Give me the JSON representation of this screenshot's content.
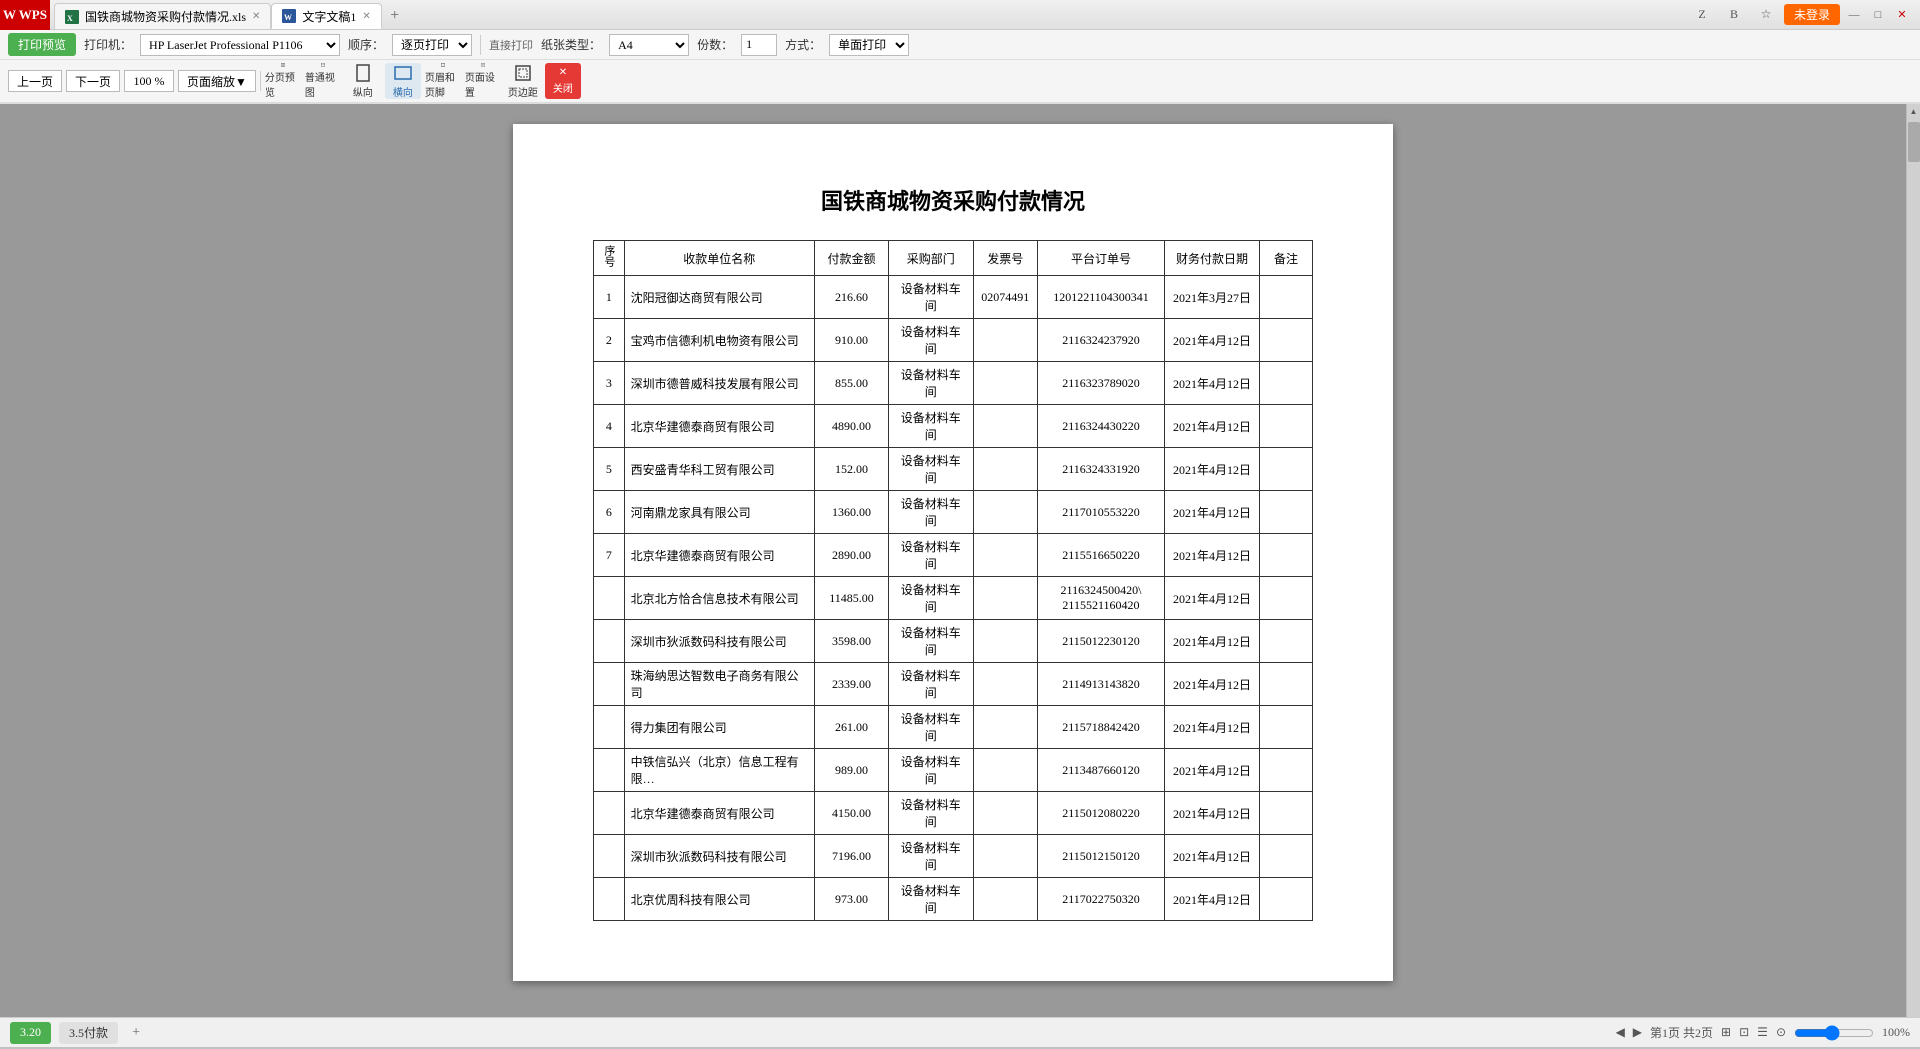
{
  "titlebar": {
    "wps_logo": "W WPS",
    "tabs": [
      {
        "id": "tab1",
        "label": "国铁商城物资采购付款情况.xls",
        "active": false,
        "icon": "xlsx"
      },
      {
        "id": "tab2",
        "label": "文字文稿1",
        "active": true,
        "icon": "doc"
      }
    ],
    "new_tab": "+",
    "right_buttons": [
      "Z",
      "B",
      "☆"
    ],
    "login_label": "未登录",
    "win_min": "—",
    "win_max": "□",
    "win_close": "✕"
  },
  "toolbar": {
    "print_preview_label": "打印预览",
    "printer_label": "打印机：",
    "printer_value": "HP LaserJet Professional P1106",
    "order_label": "顺序：",
    "order_value": "逐页打印",
    "paper_label": "纸张类型：",
    "paper_value": "A4",
    "copies_label": "份数：",
    "copies_value": "1",
    "mode_label": "方式：",
    "mode_value": "单面打印",
    "direct_print": "直接打印"
  },
  "toolbar2": {
    "prev_label": "上一页",
    "next_label": "下一页",
    "zoom_value": "100 %",
    "zoom_label": "页面缩放▼",
    "buttons": [
      {
        "id": "split-preview",
        "label": "分页预览",
        "active": false
      },
      {
        "id": "normal-view",
        "label": "普通视图",
        "active": false
      },
      {
        "id": "portrait",
        "label": "纵向",
        "active": false
      },
      {
        "id": "landscape",
        "label": "横向",
        "active": true
      },
      {
        "id": "header-footer",
        "label": "页眉和页脚",
        "active": false
      },
      {
        "id": "page-setup",
        "label": "页面设置",
        "active": false
      },
      {
        "id": "margins",
        "label": "页边距",
        "active": false
      },
      {
        "id": "close",
        "label": "关闭",
        "active": false
      }
    ]
  },
  "document": {
    "title": "国铁商城物资采购付款情况",
    "table": {
      "headers": [
        "序号",
        "收款单位名称",
        "付款金额",
        "采购部门",
        "发票号",
        "平台订单号",
        "财务付款日期",
        "备注"
      ],
      "rows": [
        {
          "seq": "1",
          "name": "沈阳冠御达商贸有限公司",
          "amount": "216.60",
          "dept": "设备材料车间",
          "invoice": "02074491",
          "order": "1201221104300341",
          "date": "2021年3月27日",
          "remark": ""
        },
        {
          "seq": "2",
          "name": "宝鸡市信德利机电物资有限公司",
          "amount": "910.00",
          "dept": "设备材料车间",
          "invoice": "",
          "order": "2116324237920",
          "date": "2021年4月12日",
          "remark": ""
        },
        {
          "seq": "3",
          "name": "深圳市德普威科技发展有限公司",
          "amount": "855.00",
          "dept": "设备材料车间",
          "invoice": "",
          "order": "2116323789020",
          "date": "2021年4月12日",
          "remark": ""
        },
        {
          "seq": "4",
          "name": "北京华建德泰商贸有限公司",
          "amount": "4890.00",
          "dept": "设备材料车间",
          "invoice": "",
          "order": "2116324430220",
          "date": "2021年4月12日",
          "remark": ""
        },
        {
          "seq": "5",
          "name": "西安盛青华科工贸有限公司",
          "amount": "152.00",
          "dept": "设备材料车间",
          "invoice": "",
          "order": "2116324331920",
          "date": "2021年4月12日",
          "remark": ""
        },
        {
          "seq": "6",
          "name": "河南鼎龙家具有限公司",
          "amount": "1360.00",
          "dept": "设备材料车间",
          "invoice": "",
          "order": "2117010553220",
          "date": "2021年4月12日",
          "remark": ""
        },
        {
          "seq": "7",
          "name": "北京华建德泰商贸有限公司",
          "amount": "2890.00",
          "dept": "设备材料车间",
          "invoice": "",
          "order": "2115516650220",
          "date": "2021年4月12日",
          "remark": ""
        },
        {
          "seq": "",
          "name": "北京北方恰合信息技术有限公司",
          "amount": "11485.00",
          "dept": "设备材料车间",
          "invoice": "",
          "order": "2116324500420\\\n2115521160420",
          "date": "2021年4月12日",
          "remark": ""
        },
        {
          "seq": "",
          "name": "深圳市狄派数码科技有限公司",
          "amount": "3598.00",
          "dept": "设备材料车间",
          "invoice": "",
          "order": "2115012230120",
          "date": "2021年4月12日",
          "remark": ""
        },
        {
          "seq": "",
          "name": "珠海纳思达智数电子商务有限公司",
          "amount": "2339.00",
          "dept": "设备材料车间",
          "invoice": "",
          "order": "2114913143820",
          "date": "2021年4月12日",
          "remark": ""
        },
        {
          "seq": "",
          "name": "得力集团有限公司",
          "amount": "261.00",
          "dept": "设备材料车间",
          "invoice": "",
          "order": "2115718842420",
          "date": "2021年4月12日",
          "remark": ""
        },
        {
          "seq": "",
          "name": "中铁信弘兴（北京）信息工程有限责任公司",
          "amount": "989.00",
          "dept": "设备材料车间",
          "invoice": "",
          "order": "2113487660120",
          "date": "2021年4月12日",
          "remark": ""
        },
        {
          "seq": "",
          "name": "北京华建德泰商贸有限公司",
          "amount": "4150.00",
          "dept": "设备材料车间",
          "invoice": "",
          "order": "2115012080220",
          "date": "2021年4月12日",
          "remark": ""
        },
        {
          "seq": "",
          "name": "深圳市狄派数码科技有限公司",
          "amount": "7196.00",
          "dept": "设备材料车间",
          "invoice": "",
          "order": "2115012150120",
          "date": "2021年4月12日",
          "remark": ""
        },
        {
          "seq": "",
          "name": "北京优周科技有限公司",
          "amount": "973.00",
          "dept": "设备材料车间",
          "invoice": "",
          "order": "2117022750320",
          "date": "2021年4月12日",
          "remark": ""
        }
      ]
    }
  },
  "statusbar": {
    "tab1_label": "3.20",
    "tab2_label": "3.5付款",
    "add_label": "+",
    "page_info": "第1页 共2页",
    "scroll_left": "◀",
    "scroll_right": "▶",
    "zoom_100": "100%",
    "view_icons": [
      "⊞",
      "⊡",
      "☰",
      "⊙"
    ]
  }
}
